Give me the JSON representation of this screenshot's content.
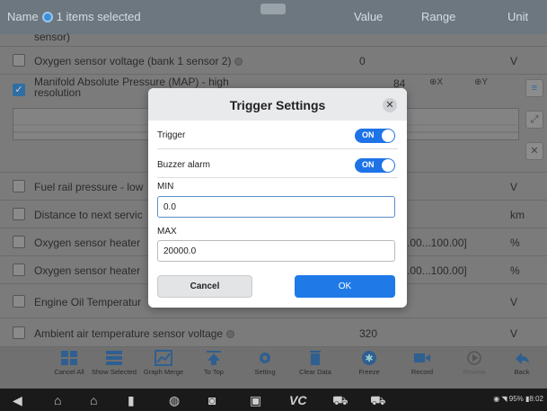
{
  "header": {
    "title": "Name",
    "selection": "1 items selected",
    "col_value": "Value",
    "col_range": "Range",
    "col_unit": "Unit"
  },
  "rows": [
    {
      "label": "sensor)",
      "value": "",
      "range": "",
      "unit": ""
    },
    {
      "label": "Oxygen sensor voltage (bank 1 sensor 2)",
      "value": "0",
      "range": "",
      "unit": "V"
    },
    {
      "label": "Fuel rail pressure - low",
      "value": "",
      "range": "",
      "unit": "V"
    },
    {
      "label": "Distance to next servic",
      "value": "",
      "range": "",
      "unit": "km"
    },
    {
      "label": "Oxygen sensor heater",
      "value": "",
      "range": ".00...100.00]",
      "unit": "%"
    },
    {
      "label": "Oxygen sensor heater",
      "value": "",
      "range": ".00...100.00]",
      "unit": "%"
    },
    {
      "label": "Engine Oil Temperatur",
      "value": "",
      "range": "",
      "unit": "V"
    },
    {
      "label": "Ambient air temperature sensor voltage",
      "value": "320",
      "range": "",
      "unit": "V"
    }
  ],
  "graph_row": {
    "label": "Manifold Absolute Pressure (MAP) - high resolution",
    "value_partial": "84",
    "zoom_x": "X",
    "zoom_y": "Y",
    "zoom_mult": "x1"
  },
  "dialog": {
    "title": "Trigger Settings",
    "trigger_label": "Trigger",
    "trigger_state": "ON",
    "buzzer_label": "Buzzer alarm",
    "buzzer_state": "ON",
    "min_label": "MIN",
    "min_value": "0.0",
    "max_label": "MAX",
    "max_value": "20000.0",
    "cancel_label": "Cancel",
    "ok_label": "OK"
  },
  "toolbar": [
    {
      "label": "Cancel All",
      "icon": "grid-icon"
    },
    {
      "label": "Show Selected",
      "icon": "list-grid-icon"
    },
    {
      "label": "Graph Merge",
      "icon": "graph-icon"
    },
    {
      "label": "To Top",
      "icon": "to-top-icon"
    },
    {
      "label": "Setting",
      "icon": "settings-icon"
    },
    {
      "label": "Clear Data",
      "icon": "trash-icon"
    },
    {
      "label": "Freeze",
      "icon": "snowflake-icon"
    },
    {
      "label": "Record",
      "icon": "camera-record-icon"
    },
    {
      "label": "Review",
      "icon": "play-icon"
    },
    {
      "label": "Back",
      "icon": "back-arrow-icon"
    }
  ],
  "status_bar": {
    "battery": "95%",
    "time": "8:02"
  },
  "colors": {
    "accent": "#1f7ae8",
    "toggle_on": "#1e73e8",
    "header_bg": "#6c7780"
  }
}
